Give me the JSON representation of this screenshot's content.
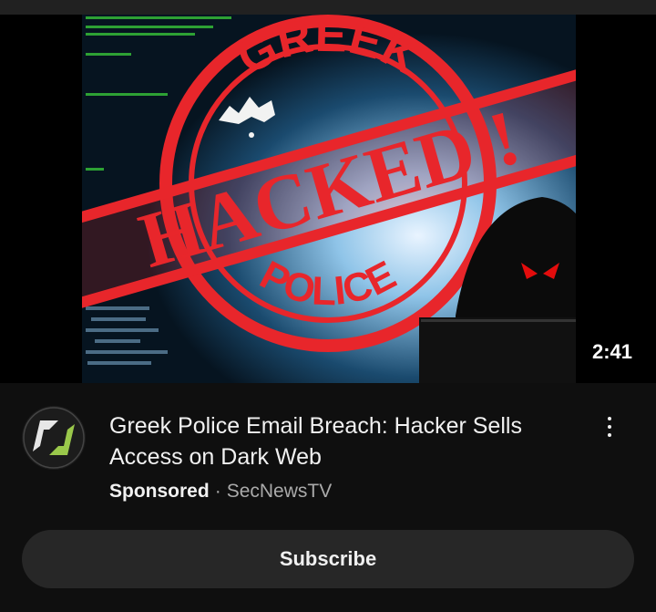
{
  "video": {
    "duration": "2:41",
    "thumbnail_text": {
      "top_arc": "GREEK",
      "stamp": "HACKED !",
      "bottom_arc": "POLICE"
    }
  },
  "ad": {
    "title": "Greek Police Email Breach: Hacker Sells Access on Dark Web",
    "sponsored_label": "Sponsored",
    "separator": "·",
    "channel": "SecNewsTV",
    "subscribe_label": "Subscribe"
  },
  "colors": {
    "background": "#0f0f0f",
    "stamp_red": "#e8262b",
    "subscribe_bg": "#272727",
    "avatar_green": "#9ac84b"
  },
  "icons": {
    "more": "more-vert-icon",
    "avatar": "channel-logo"
  }
}
